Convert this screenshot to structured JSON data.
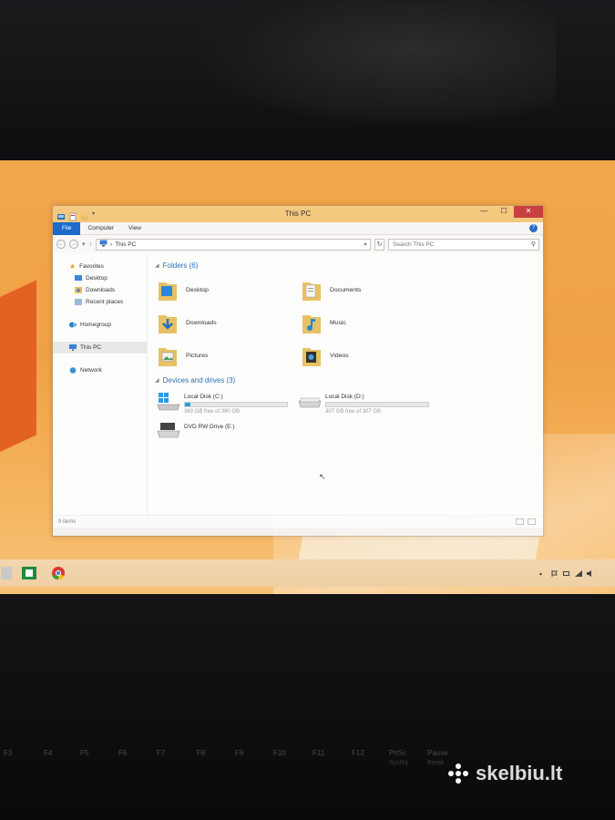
{
  "window": {
    "title": "This PC",
    "controls": {
      "minimize": "—",
      "maximize": "☐",
      "close": "✕"
    }
  },
  "ribbon": {
    "tabs": [
      "File",
      "Computer",
      "View"
    ],
    "help": "?"
  },
  "address": {
    "path_separator": "›",
    "location": "This PC",
    "search_placeholder": "Search This PC"
  },
  "nav_pane": {
    "favorites": "Favorites",
    "favorites_items": [
      "Desktop",
      "Downloads",
      "Recent places"
    ],
    "homegroup": "Homegroup",
    "this_pc": "This PC",
    "network": "Network"
  },
  "folders": {
    "header": "Folders (6)",
    "items": [
      {
        "label": "Desktop",
        "icon": "desktop-folder-icon"
      },
      {
        "label": "Documents",
        "icon": "documents-folder-icon"
      },
      {
        "label": "Downloads",
        "icon": "downloads-folder-icon"
      },
      {
        "label": "Music",
        "icon": "music-folder-icon"
      },
      {
        "label": "Pictures",
        "icon": "pictures-folder-icon"
      },
      {
        "label": "Videos",
        "icon": "videos-folder-icon"
      }
    ]
  },
  "devices": {
    "header": "Devices and drives (3)",
    "items": [
      {
        "name": "Local Disk (C:)",
        "free": "369 GB free of 390 GB",
        "used_fraction": 0.05
      },
      {
        "name": "Local Disk (D:)",
        "free": "307 GB free of 307 GB",
        "used_fraction": 0.0
      },
      {
        "name": "DVD RW Drive (E:)"
      }
    ]
  },
  "status": {
    "items_count": "9 items"
  },
  "colors": {
    "accent": "#1c6bc9",
    "group_header": "#2a6fb8",
    "drive_bar": "#26a0da",
    "title_bar": "#f4c87f",
    "desktop": "#f2a64a"
  },
  "keyboard": {
    "keys_row1": [
      "F3",
      "F4",
      "F5",
      "F6",
      "F7",
      "F8",
      "F9",
      "F10",
      "F11",
      "F12",
      "PrtSc",
      "Pause"
    ],
    "keys_row2": [
      "SysRq",
      "Break"
    ]
  },
  "watermark": "skelbiu.lt"
}
